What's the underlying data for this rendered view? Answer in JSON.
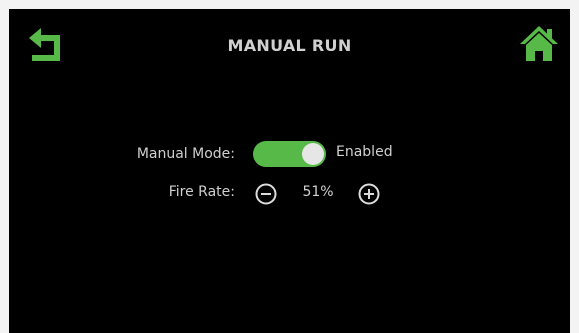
{
  "header": {
    "title": "MANUAL RUN",
    "back_icon": "back-arrow-icon",
    "home_icon": "home-icon"
  },
  "manual_mode": {
    "label": "Manual Mode:",
    "toggle_on": true,
    "status": "Enabled"
  },
  "fire_rate": {
    "label": "Fire Rate:",
    "value": "51%",
    "decrement_icon": "minus-circle-icon",
    "increment_icon": "plus-circle-icon"
  },
  "colors": {
    "accent_green": "#57b947",
    "background": "#000000",
    "text": "#d0d0d0"
  }
}
